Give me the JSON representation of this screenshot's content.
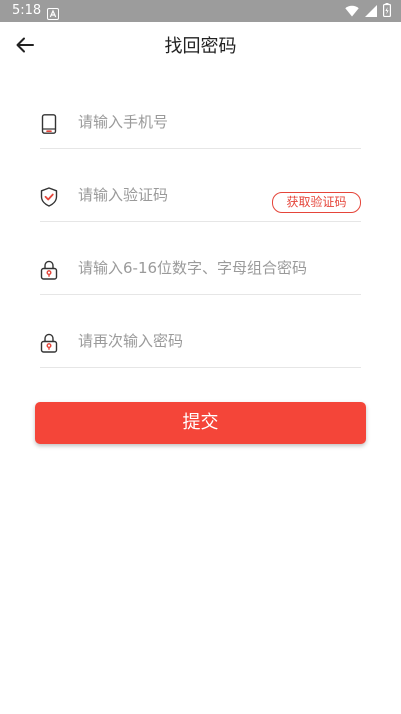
{
  "status_bar": {
    "time": "5:18",
    "app_icon": "a-letter-icon",
    "icons": [
      "wifi-icon",
      "signal-icon",
      "battery-icon"
    ],
    "background": "#9c9c9c"
  },
  "header": {
    "title": "找回密码",
    "back_icon": "arrow-left-icon"
  },
  "form": {
    "phone": {
      "placeholder": "请输入手机号",
      "icon": "phone-icon"
    },
    "code": {
      "placeholder": "请输入验证码",
      "icon": "shield-check-icon",
      "button_label": "获取验证码"
    },
    "password": {
      "placeholder": "请输入6-16位数字、字母组合密码",
      "icon": "lock-icon"
    },
    "confirm": {
      "placeholder": "请再次输入密码",
      "icon": "lock-icon"
    }
  },
  "submit": {
    "label": "提交"
  },
  "colors": {
    "accent": "#f44539",
    "icon_red": "#e5453a",
    "text_dark": "#222222",
    "placeholder": "#9a9a9a",
    "divider": "#e6e6e6"
  }
}
